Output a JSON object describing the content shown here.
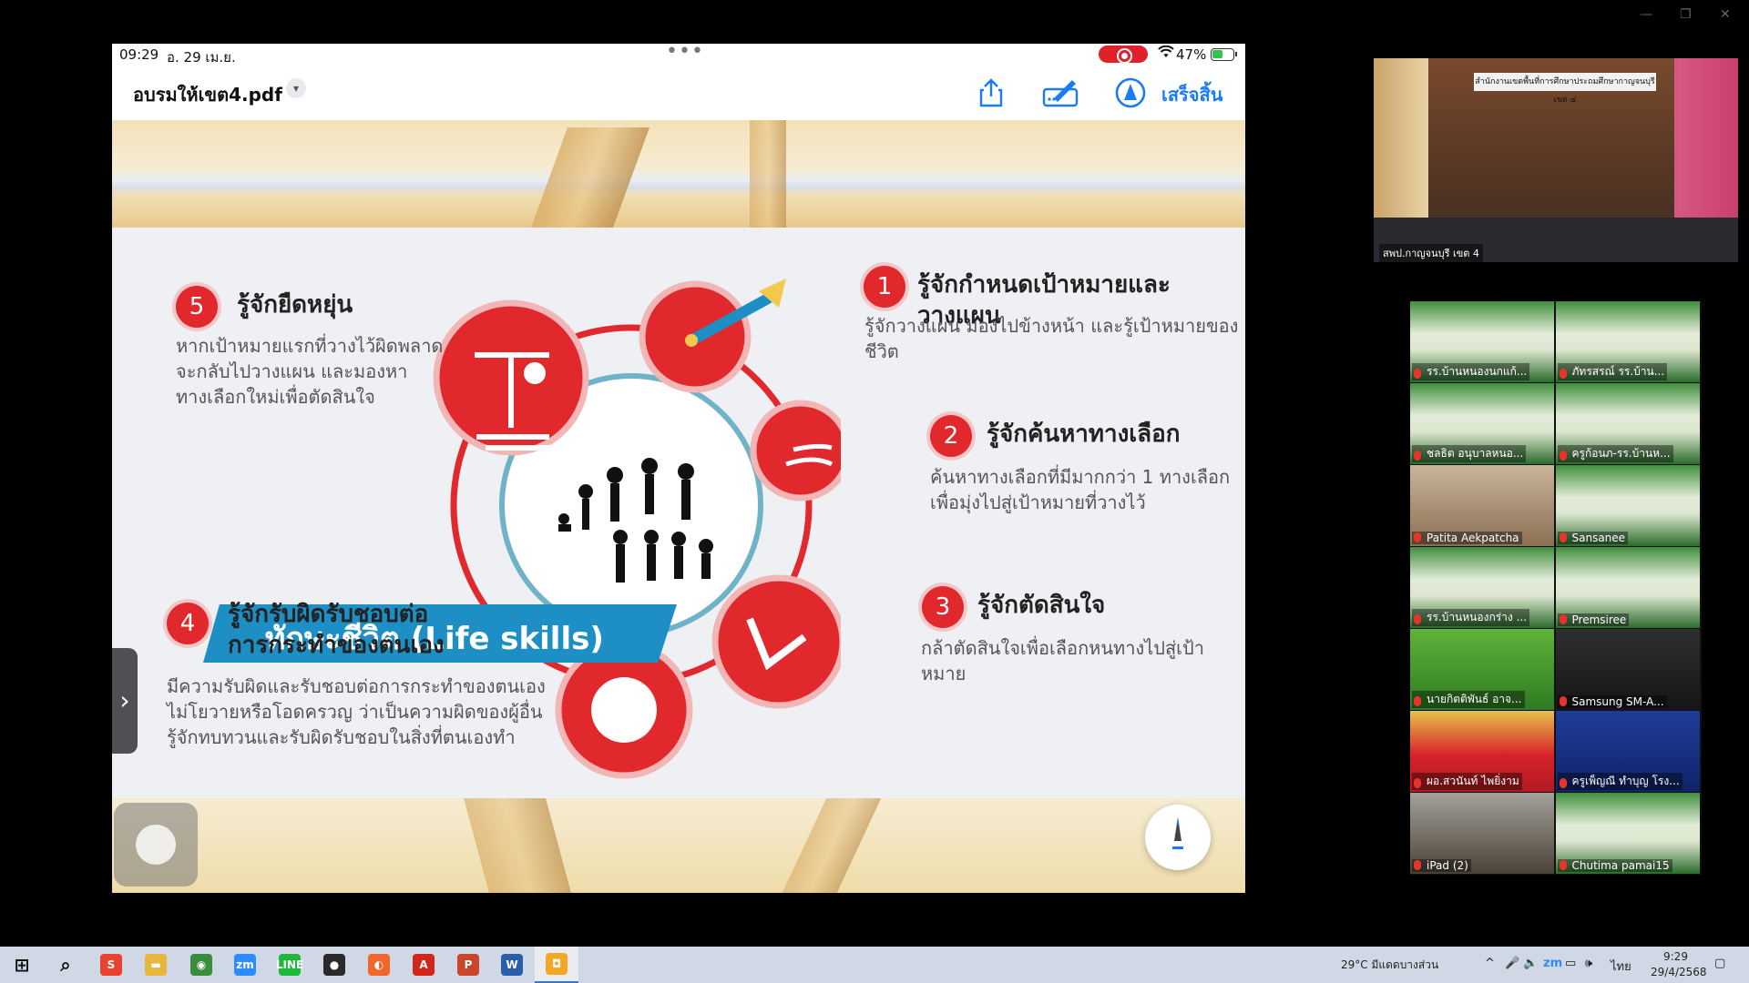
{
  "ipad": {
    "status": {
      "time": "09:29",
      "date": "อ. 29 เม.ย.",
      "battery": "47%"
    },
    "nav": {
      "doc_title": "อบรมให้เขต4.pdf",
      "done_label": "เสร็จสิ้น"
    }
  },
  "slide": {
    "banner": "ทักษะชีวิต (Life skills)",
    "skills": [
      {
        "num": "1",
        "title": "รู้จักกำหนดเป้าหมายและวางแผน",
        "desc": [
          "รู้จักวางแผน มองไปข้างหน้า และรู้เป้าหมายของชีวิต"
        ]
      },
      {
        "num": "2",
        "title": "รู้จักค้นหาทางเลือก",
        "desc": [
          "ค้นหาทางเลือกที่มีมากกว่า 1 ทางเลือก",
          "เพื่อมุ่งไปสู่เป้าหมายที่วางไว้"
        ]
      },
      {
        "num": "3",
        "title": "รู้จักตัดสินใจ",
        "desc": [
          "กล้าตัดสินใจเพื่อเลือกหนทางไปสู่เป้าหมาย"
        ]
      },
      {
        "num": "4",
        "title": [
          "รู้จักรับผิดรับชอบต่อ",
          "การกระทำของตนเอง"
        ],
        "desc": [
          "มีความรับผิดและรับชอบต่อการกระทำของตนเอง",
          "ไม่โยวายหรือโอดครวญ ว่าเป็นความผิดของผู้อื่น",
          "รู้จักทบทวนและรับผิดรับชอบในสิ่งที่ตนเองทำ"
        ]
      },
      {
        "num": "5",
        "title": "รู้จักยืดหยุ่น",
        "desc": [
          "หากเป้าหมายแรกที่วางไว้ผิดพลาด",
          "จะกลับไปวางแผน และมองหา",
          "ทางเลือกใหม่เพื่อตัดสินใจ"
        ]
      }
    ]
  },
  "zoom": {
    "speaker_name": "สพป.กาญจนบุรี เขต 4",
    "speaker_banner": "สำนักงานเขตพื้นที่การศึกษาประถมศึกษากาญจนบุรี เขต ๔",
    "participants": [
      {
        "name": "รร.บ้านหนองนกแก้...",
        "style": ""
      },
      {
        "name": "ภัทรสรณ์ รร.บ้าน...",
        "style": ""
      },
      {
        "name": "ชลธิต อนุบาลหนอ...",
        "style": ""
      },
      {
        "name": "ครูก้อนภ-รร.บ้านห...",
        "style": ""
      },
      {
        "name": "Patita Aekpatcha",
        "style": "room"
      },
      {
        "name": "Sansanee",
        "style": ""
      },
      {
        "name": "รร.บ้านหนองกร่าง ...",
        "style": ""
      },
      {
        "name": "Premsiree",
        "style": ""
      },
      {
        "name": "นายกิตติพันธ์ อาจ...",
        "style": "green2"
      },
      {
        "name": "Samsung SM-A...",
        "style": "dark"
      },
      {
        "name": "ผอ.สวนันท์ ไพยิ่งาม",
        "style": "crowd"
      },
      {
        "name": "ครูเพ็ญณี ทำบุญ โรง...",
        "style": "nt"
      },
      {
        "name": "iPad (2)",
        "style": "person"
      },
      {
        "name": "Chutima pamai15",
        "style": ""
      }
    ]
  },
  "taskbar": {
    "apps": [
      {
        "name": "start",
        "label": "⊞",
        "color": "#0a0a0a"
      },
      {
        "name": "search",
        "label": "⌕",
        "color": "#0a0a0a"
      },
      {
        "name": "sogou",
        "label": "S",
        "color": "#e8432f"
      },
      {
        "name": "file-explorer",
        "label": "▬",
        "color": "#e7b63c"
      },
      {
        "name": "chrome",
        "label": "◉",
        "color": "#3b8d3e"
      },
      {
        "name": "zoom",
        "label": "zm",
        "color": "#2d8cff"
      },
      {
        "name": "line",
        "label": "LINE",
        "color": "#1fb83a"
      },
      {
        "name": "obs",
        "label": "●",
        "color": "#2a2a2a"
      },
      {
        "name": "firefox",
        "label": "◐",
        "color": "#f0662c"
      },
      {
        "name": "acrobat",
        "label": "A",
        "color": "#d0261b"
      },
      {
        "name": "powerpoint",
        "label": "P",
        "color": "#c9462b"
      },
      {
        "name": "word",
        "label": "W",
        "color": "#2b5ea8"
      },
      {
        "name": "active-app",
        "label": "◘",
        "color": "#f5a623"
      }
    ],
    "weather": "29°C  มีแดดบางส่วน",
    "lang": "ไทย",
    "clock_time": "9:29",
    "clock_date": "29/4/2568"
  }
}
